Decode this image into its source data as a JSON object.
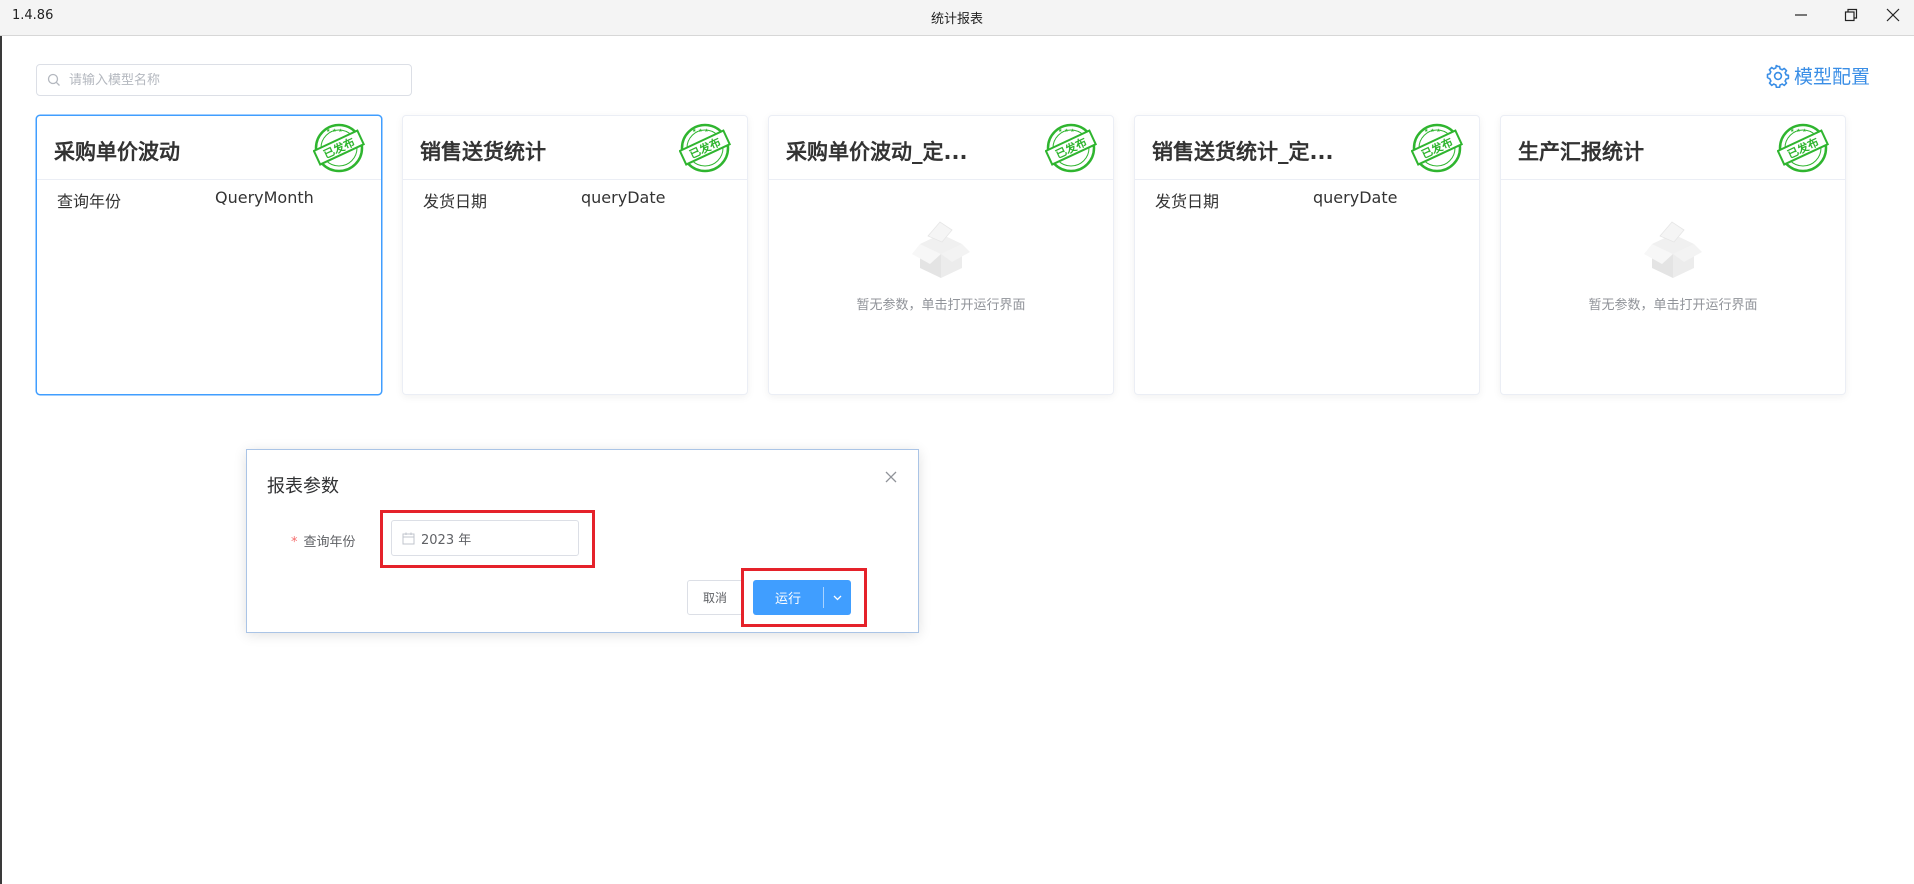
{
  "window": {
    "version": "1.4.86",
    "title": "统计报表"
  },
  "search": {
    "placeholder": "请输入模型名称"
  },
  "header": {
    "model_config_label": "模型配置"
  },
  "cards": [
    {
      "title": "采购单价波动",
      "stamp": "已发布",
      "param_name": "查询年份",
      "param_key": "QueryMonth"
    },
    {
      "title": "销售送货统计",
      "stamp": "已发布",
      "param_name": "发货日期",
      "param_key": "queryDate"
    },
    {
      "title": "采购单价波动_定...",
      "stamp": "已发布",
      "empty_text": "暂无参数，单击打开运行界面"
    },
    {
      "title": "销售送货统计_定...",
      "stamp": "已发布",
      "param_name": "发货日期",
      "param_key": "queryDate"
    },
    {
      "title": "生产汇报统计",
      "stamp": "已发布",
      "empty_text": "暂无参数，单击打开运行界面"
    }
  ],
  "dialog": {
    "title": "报表参数",
    "required_mark": "*",
    "field_label": "查询年份",
    "field_value": "2023 年",
    "cancel_label": "取消",
    "run_label": "运行"
  },
  "colors": {
    "accent": "#409eff",
    "stamp": "#2fb52f",
    "highlight": "#e5222a"
  }
}
